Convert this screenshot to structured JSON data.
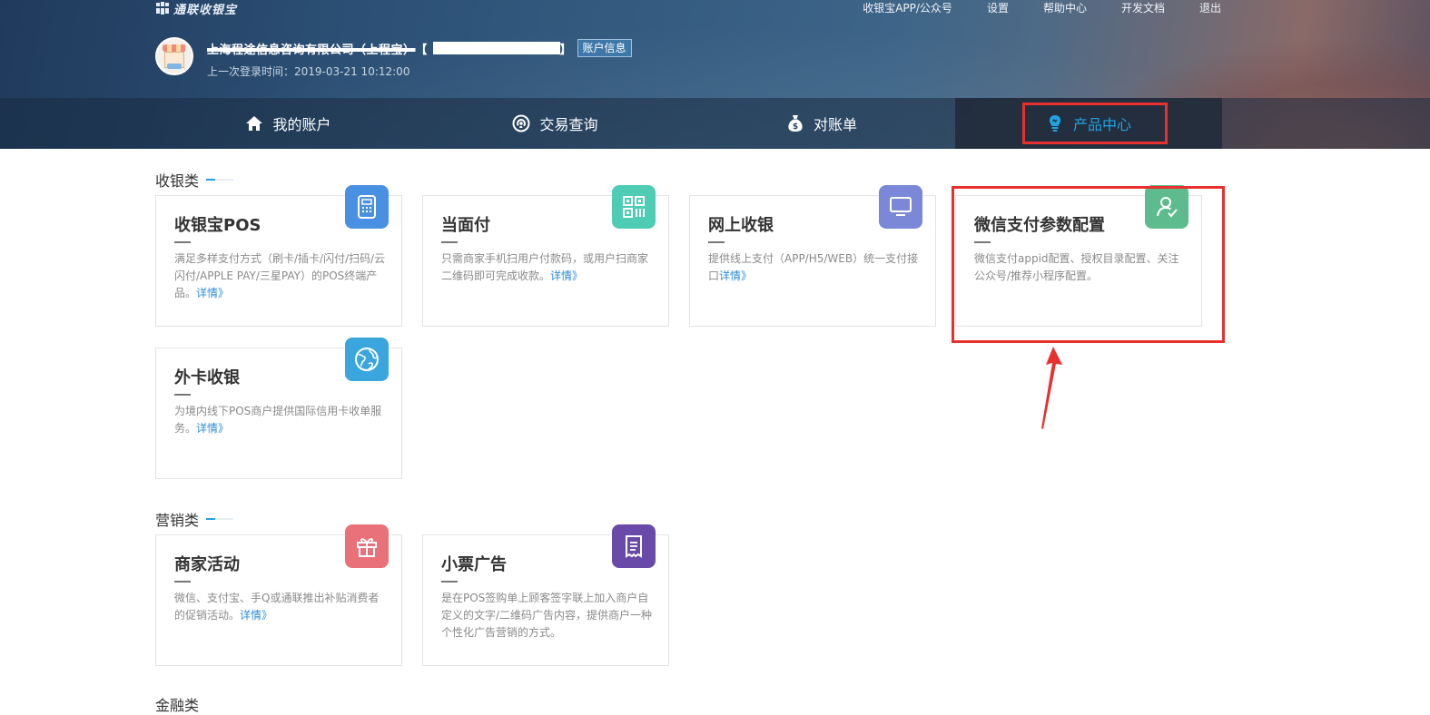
{
  "brand": {
    "name": "通联收银宝"
  },
  "topnav": {
    "items": [
      "收银宝APP/公众号",
      "设置",
      "帮助中心",
      "开发文档",
      "退出"
    ]
  },
  "account": {
    "company_name": "上海程途信息咨询有限公司（上程宝）",
    "bracket_open": "【",
    "bracket_close": "】",
    "info_button": "账户信息",
    "last_login": "上一次登录时间：2019-03-21 10:12:00"
  },
  "mainnav": {
    "tabs": [
      {
        "label": "我的账户",
        "icon": "home-icon"
      },
      {
        "label": "交易查询",
        "icon": "search-circle-icon"
      },
      {
        "label": "对账单",
        "icon": "money-bag-icon"
      },
      {
        "label": "产品中心",
        "icon": "lightbulb-icon",
        "active": true
      }
    ]
  },
  "sections": [
    {
      "title": "收银类",
      "cards": [
        {
          "title": "收银宝POS",
          "desc": "满足多样支付方式（刷卡/插卡/闪付/扫码/云闪付/APPLE PAY/三星PAY）的POS终端产品。",
          "link": "详情》",
          "icon": "pos-icon",
          "color": "#4a90e2"
        },
        {
          "title": "当面付",
          "desc": "只需商家手机扫用户付款码，或用户扫商家二维码即可完成收款。",
          "link": "详情》",
          "icon": "qrcode-icon",
          "color": "#4ecdb4"
        },
        {
          "title": "网上收银",
          "desc": "提供线上支付（APP/H5/WEB）统一支付接口",
          "link": "详情》",
          "icon": "monitor-icon",
          "color": "#7b88d8"
        },
        {
          "title": "微信支付参数配置",
          "desc": "微信支付appid配置、授权目录配置、关注公众号/推荐小程序配置。",
          "link": "",
          "icon": "user-check-icon",
          "color": "#5dbb8e"
        },
        {
          "title": "外卡收银",
          "desc": "为境内线下POS商户提供国际信用卡收单服务。",
          "link": "详情》",
          "icon": "globe-icon",
          "color": "#3aa6dd"
        }
      ]
    },
    {
      "title": "营销类",
      "cards": [
        {
          "title": "商家活动",
          "desc": "微信、支付宝、手Q或通联推出补贴消费者的促销活动。",
          "link": "详情》",
          "icon": "gift-icon",
          "color": "#e8717a"
        },
        {
          "title": "小票广告",
          "desc": "是在POS签购单上顾客签字联上加入商户自定义的文字/二维码广告内容，提供商户一种个性化广告营销的方式。",
          "link": "",
          "icon": "receipt-icon",
          "color": "#6a4aa8"
        }
      ]
    },
    {
      "title": "金融类"
    }
  ],
  "colors": {
    "accent": "#20a3e0",
    "highlight": "#e8302f",
    "link": "#2d8cd6"
  }
}
